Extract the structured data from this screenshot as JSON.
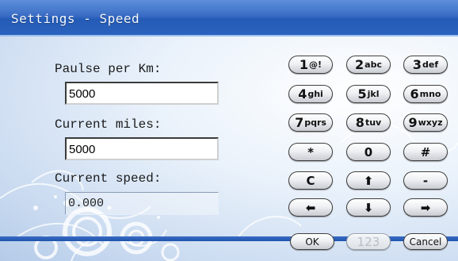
{
  "window": {
    "title": "Settings - Speed"
  },
  "form": {
    "pulse_label": "Paulse per Km:",
    "pulse_value": "5000",
    "miles_label": "Current miles:",
    "miles_value": "5000",
    "speed_label": "Current speed:",
    "speed_value": "0.000"
  },
  "keypad": {
    "row1": [
      {
        "main": "1",
        "sub": "@!"
      },
      {
        "main": "2",
        "sub": "abc"
      },
      {
        "main": "3",
        "sub": "def"
      }
    ],
    "row2": [
      {
        "main": "4",
        "sub": "ghi"
      },
      {
        "main": "5",
        "sub": "jkl"
      },
      {
        "main": "6",
        "sub": "mno"
      }
    ],
    "row3": [
      {
        "main": "7",
        "sub": "pqrs"
      },
      {
        "main": "8",
        "sub": "tuv"
      },
      {
        "main": "9",
        "sub": "wxyz"
      }
    ],
    "row4": [
      {
        "main": "*"
      },
      {
        "main": "0"
      },
      {
        "main": "#"
      }
    ],
    "row5": [
      {
        "main": "C"
      },
      {
        "icon": "arrow-up-icon"
      },
      {
        "main": "-"
      }
    ],
    "row6": [
      {
        "icon": "arrow-left-icon"
      },
      {
        "icon": "arrow-down-icon"
      },
      {
        "icon": "arrow-right-icon"
      }
    ]
  },
  "actions": {
    "ok": "OK",
    "backspace": "123",
    "cancel": "Cancel"
  },
  "colors": {
    "titlebar": "#2a63bf",
    "title_text": "#f4f8ff",
    "background": "#eaf2fb"
  }
}
